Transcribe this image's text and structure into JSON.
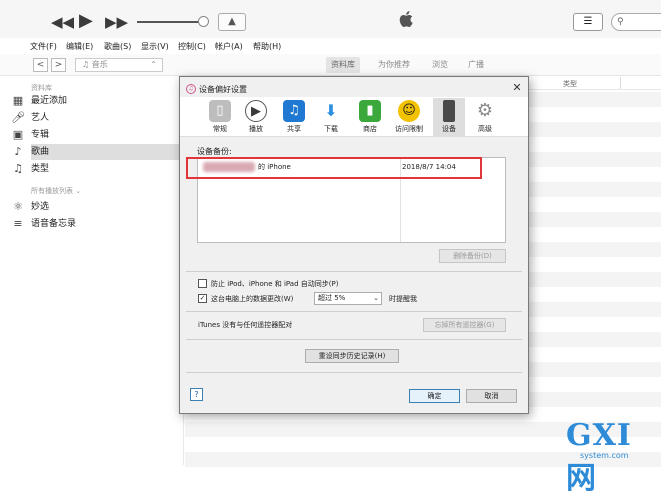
{
  "player": {
    "controls": [
      "rewind-icon",
      "play-icon",
      "fast-forward-icon"
    ],
    "airplay_icon": "airplay-icon",
    "apple_icon": "apple-logo",
    "list_icon": "list-view-icon",
    "search_icon": "search-icon"
  },
  "menu": [
    "文件(F)",
    "编辑(E)",
    "歌曲(S)",
    "显示(V)",
    "控制(C)",
    "帐户(A)",
    "帮助(H)"
  ],
  "nav": {
    "back": "<",
    "forward": ">",
    "media_selector": "♫ 音乐",
    "media_arrow": "⌃",
    "tabs": [
      "资料库",
      "为你推荐",
      "浏览",
      "广播"
    ],
    "active_tab": "资料库"
  },
  "sidebar": {
    "library_header": "资料库",
    "items": [
      {
        "label": "最近添加",
        "icon": "calendar-grid-icon"
      },
      {
        "label": "艺人",
        "icon": "microphone-icon"
      },
      {
        "label": "专辑",
        "icon": "album-icon"
      },
      {
        "label": "歌曲",
        "icon": "music-note-icon"
      },
      {
        "label": "类型",
        "icon": "genre-icon"
      }
    ],
    "playlists_header": "所有播放列表 ⌄",
    "playlists": [
      {
        "label": "妙选",
        "icon": "genius-icon"
      },
      {
        "label": "语音备忘录",
        "icon": "playlist-icon"
      }
    ]
  },
  "list_columns": [
    "类型"
  ],
  "dialog": {
    "title": "设备偏好设置",
    "close": "✕",
    "toolbar": [
      {
        "label": "常规",
        "icon": "general-switch-icon",
        "color": "#9a9a9a"
      },
      {
        "label": "播放",
        "icon": "play-circle-icon",
        "color": "#3a3a3a"
      },
      {
        "label": "共享",
        "icon": "sharing-icon",
        "color": "#1f78d1"
      },
      {
        "label": "下载",
        "icon": "download-icon",
        "color": "#2d8fe0"
      },
      {
        "label": "商店",
        "icon": "store-bag-icon",
        "color": "#3aa83a"
      },
      {
        "label": "访问限制",
        "icon": "restrictions-icon",
        "color": "#e7b000"
      },
      {
        "label": "设备",
        "icon": "device-phone-icon",
        "color": "#4a4a4a"
      },
      {
        "label": "高级",
        "icon": "advanced-gear-icon",
        "color": "#8a8a8a"
      }
    ],
    "active_tab": "设备",
    "backups_label": "设备备份:",
    "backup_row": {
      "name_suffix": "的 iPhone",
      "date": "2018/8/7 14:04"
    },
    "delete_backup": "删除备份(D)",
    "prevent_sync_label": "防止 iPod、iPhone 和 iPad 自动同步(P)",
    "prevent_sync_checked": false,
    "warn_label": "这台电脑上的数据更改(W)",
    "warn_checked": true,
    "warn_threshold": "超过 5%",
    "warn_suffix": "时提醒我",
    "remotes_text": "iTunes 没有与任何遥控器配对",
    "forget_remotes": "忘掉所有遥控器(G)",
    "reset_history": "重设同步历史记录(H)",
    "help": "?",
    "ok": "确定",
    "cancel": "取消"
  },
  "watermark": {
    "logo": "GXI网",
    "sub": "system.com"
  }
}
